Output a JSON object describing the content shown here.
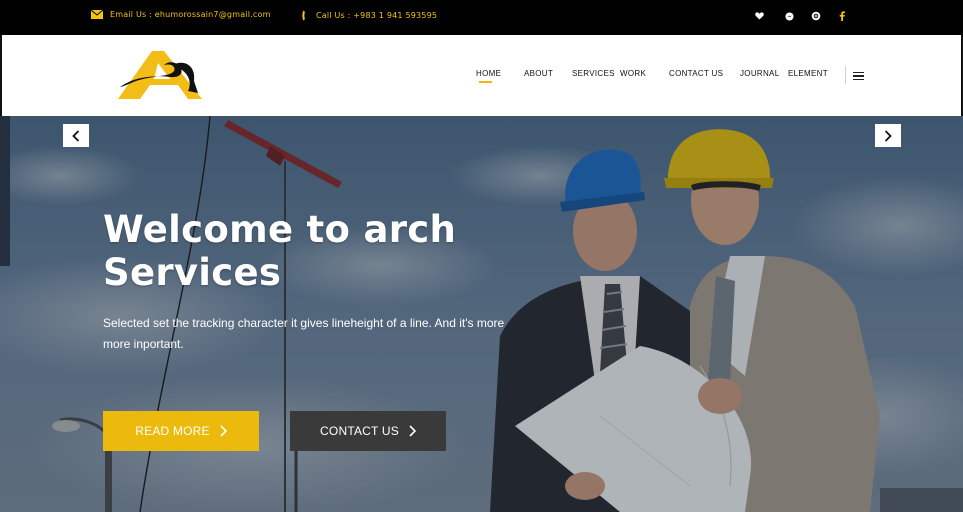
{
  "topbar": {
    "email": "Email Us : ehumorossain7@gmail.com",
    "phone": "Call Us : +983 1 941 593595",
    "social": [
      {
        "icon": "heart-icon"
      },
      {
        "icon": "messenger-icon"
      },
      {
        "icon": "globe-icon"
      },
      {
        "icon": "facebook-icon"
      }
    ]
  },
  "nav": {
    "items": [
      {
        "label": "HOME",
        "active": true
      },
      {
        "label": "ABOUT"
      },
      {
        "label": "SERVICES"
      },
      {
        "label": "WORK"
      },
      {
        "label": "CONTACT US"
      },
      {
        "label": "JOURNAL"
      },
      {
        "label": "ELEMENT"
      }
    ]
  },
  "hero": {
    "title": "Welcome to arch Services",
    "subtitle": "Selected set the tracking character it gives lineheight of a line. And it's more more inportant.",
    "read_more": "READ MORE",
    "contact_us": "CONTACT US"
  },
  "colors": {
    "accent": "#ecb90d",
    "topbar_bg": "#000000",
    "secondary_button": "#3a3a3a"
  }
}
